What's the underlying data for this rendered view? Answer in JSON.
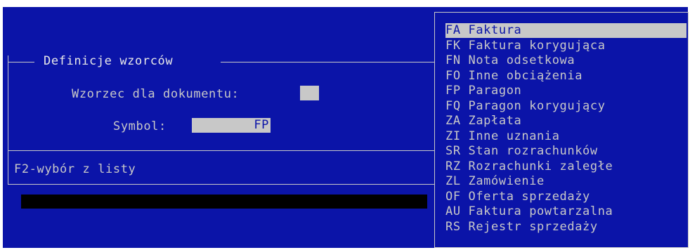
{
  "dialog": {
    "title": "Definicje wzorców",
    "document_label": "Wzorzec dla dokumentu:",
    "document_value": "",
    "symbol_label": "Symbol:",
    "symbol_value": "FP",
    "hint": "F2-wybór z listy"
  },
  "list": {
    "selected_index": 0,
    "items": [
      {
        "code": "FA",
        "name": "Faktura"
      },
      {
        "code": "FK",
        "name": "Faktura korygująca"
      },
      {
        "code": "FN",
        "name": "Nota odsetkowa"
      },
      {
        "code": "FO",
        "name": "Inne obciążenia"
      },
      {
        "code": "FP",
        "name": "Paragon"
      },
      {
        "code": "FQ",
        "name": "Paragon korygujący"
      },
      {
        "code": "ZA",
        "name": "Zapłata"
      },
      {
        "code": "ZI",
        "name": "Inne uznania"
      },
      {
        "code": "SR",
        "name": "Stan rozrachunków"
      },
      {
        "code": "RZ",
        "name": "Rozrachunki zaległe"
      },
      {
        "code": "ZL",
        "name": "Zamówienie"
      },
      {
        "code": "OF",
        "name": "Oferta sprzedaży"
      },
      {
        "code": "AU",
        "name": "Faktura powtarzalna"
      },
      {
        "code": "RS",
        "name": "Rejestr sprzedaży"
      }
    ]
  },
  "colors": {
    "background": "#0b14a8",
    "text": "#c8c8c8",
    "highlight": "#c8c8c8"
  }
}
